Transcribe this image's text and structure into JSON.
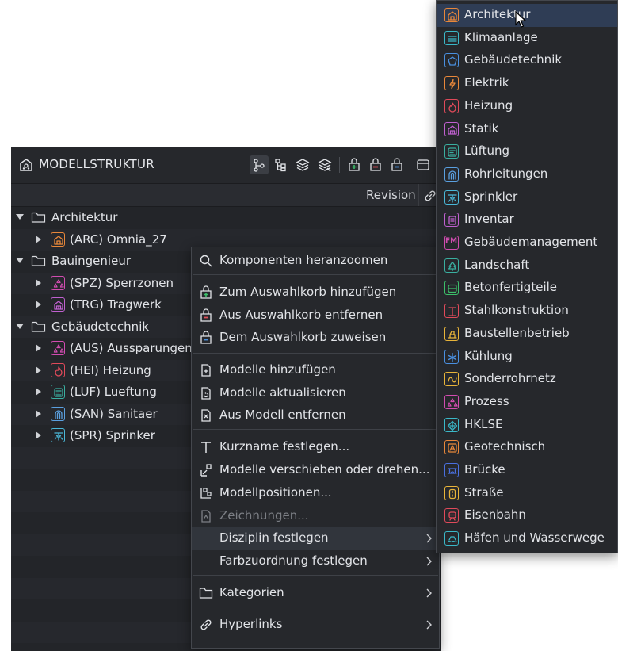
{
  "panel": {
    "title": "MODELLSTRUKTUR",
    "column_revision": "Revision",
    "tree": [
      {
        "type": "group",
        "label": "Architektur"
      },
      {
        "type": "model",
        "label": "(ARC) Omnia_27",
        "icon": "architecture-icon",
        "color": "#e8873a"
      },
      {
        "type": "group",
        "label": "Bauingenieur"
      },
      {
        "type": "model",
        "label": "(SPZ) Sperrzonen",
        "icon": "process-icon",
        "color": "#d14cb0"
      },
      {
        "type": "model",
        "label": "(TRG) Tragwerk",
        "icon": "structure-icon",
        "color": "#c060d0"
      },
      {
        "type": "group",
        "label": "Gebäudetechnik"
      },
      {
        "type": "model",
        "label": "(AUS) Aussparungen",
        "icon": "process-icon",
        "color": "#d14cb0"
      },
      {
        "type": "model",
        "label": "(HEI) Heizung",
        "icon": "heating-icon",
        "color": "#e04a5a"
      },
      {
        "type": "model",
        "label": "(LUF) Lueftung",
        "icon": "ventilation-icon",
        "color": "#3aafa0"
      },
      {
        "type": "model",
        "label": "(SAN) Sanitaer",
        "icon": "pipe-icon",
        "color": "#5aa0e0"
      },
      {
        "type": "model",
        "label": "(SPR) Sprinker",
        "icon": "sprinkler-icon",
        "color": "#4ab8d8"
      }
    ]
  },
  "context_menu": {
    "items": [
      {
        "label": "Komponenten heranzoomen",
        "icon": "search-icon"
      },
      {
        "label": "Zum Auswahlkorb hinzufügen",
        "icon": "basket-add-icon",
        "color": "#3cc06a"
      },
      {
        "label": "Aus Auswahlkorb entfernen",
        "icon": "basket-remove-icon",
        "color": "#e0505a"
      },
      {
        "label": "Dem Auswahlkorb zuweisen",
        "icon": "basket-assign-icon",
        "color": "#4a90e0"
      },
      {
        "label": "Modelle hinzufügen",
        "icon": "file-add-icon"
      },
      {
        "label": "Modelle aktualisieren",
        "icon": "file-refresh-icon"
      },
      {
        "label": "Aus Modell entfernen",
        "icon": "file-remove-icon"
      },
      {
        "label": "Kurzname festlegen...",
        "icon": "text-icon"
      },
      {
        "label": "Modelle verschieben oder drehen...",
        "icon": "move-icon"
      },
      {
        "label": "Modellpositionen...",
        "icon": "positions-icon"
      },
      {
        "label": "Zeichnungen...",
        "icon": "drawings-icon",
        "disabled": true
      },
      {
        "label": "Disziplin festlegen",
        "submenu": true
      },
      {
        "label": "Farbzuordnung festlegen",
        "submenu": true
      },
      {
        "label": "Kategorien",
        "icon": "folder-icon",
        "submenu": true
      },
      {
        "label": "Hyperlinks",
        "icon": "link-icon",
        "submenu": true
      }
    ]
  },
  "discipline_menu": {
    "items": [
      {
        "label": "Architektur",
        "icon": "architecture-icon",
        "color": "#e8873a"
      },
      {
        "label": "Klimaanlage",
        "icon": "hvac-icon",
        "color": "#3ab8c8"
      },
      {
        "label": "Gebäudetechnik",
        "icon": "building-services-icon",
        "color": "#4a90e0"
      },
      {
        "label": "Elektrik",
        "icon": "electric-icon",
        "color": "#e8873a"
      },
      {
        "label": "Heizung",
        "icon": "heating-icon",
        "color": "#e04a5a"
      },
      {
        "label": "Statik",
        "icon": "structure-icon",
        "color": "#c060d0"
      },
      {
        "label": "Lüftung",
        "icon": "ventilation-icon",
        "color": "#3aafa0"
      },
      {
        "label": "Rohrleitungen",
        "icon": "pipe-icon",
        "color": "#5aa0e0"
      },
      {
        "label": "Sprinkler",
        "icon": "sprinkler-icon",
        "color": "#4ab8d8"
      },
      {
        "label": "Inventar",
        "icon": "inventory-icon",
        "color": "#c060d0"
      },
      {
        "label": "Gebäudemanagement",
        "icon": "fm-icon",
        "color": "#d14cb0",
        "text": "FM"
      },
      {
        "label": "Landschaft",
        "icon": "landscape-icon",
        "color": "#3aafa0"
      },
      {
        "label": "Betonfertigteile",
        "icon": "precast-icon",
        "color": "#3cc06a"
      },
      {
        "label": "Stahlkonstruktion",
        "icon": "steel-icon",
        "color": "#e04a5a"
      },
      {
        "label": "Baustellenbetrieb",
        "icon": "site-icon",
        "color": "#e8b43a"
      },
      {
        "label": "Kühlung",
        "icon": "cooling-icon",
        "color": "#4a90e0"
      },
      {
        "label": "Sonderrohrnetz",
        "icon": "special-pipe-icon",
        "color": "#e8b43a"
      },
      {
        "label": "Prozess",
        "icon": "process-icon",
        "color": "#d14cb0"
      },
      {
        "label": "HKLSE",
        "icon": "hklse-icon",
        "color": "#3ab8c8"
      },
      {
        "label": "Geotechnisch",
        "icon": "geotech-icon",
        "color": "#e8873a"
      },
      {
        "label": "Brücke",
        "icon": "bridge-icon",
        "color": "#4a70e0"
      },
      {
        "label": "Straße",
        "icon": "road-icon",
        "color": "#e8b43a"
      },
      {
        "label": "Eisenbahn",
        "icon": "railway-icon",
        "color": "#e04a5a"
      },
      {
        "label": "Häfen und Wasserwege",
        "icon": "harbor-icon",
        "color": "#3ab8c8"
      }
    ]
  }
}
